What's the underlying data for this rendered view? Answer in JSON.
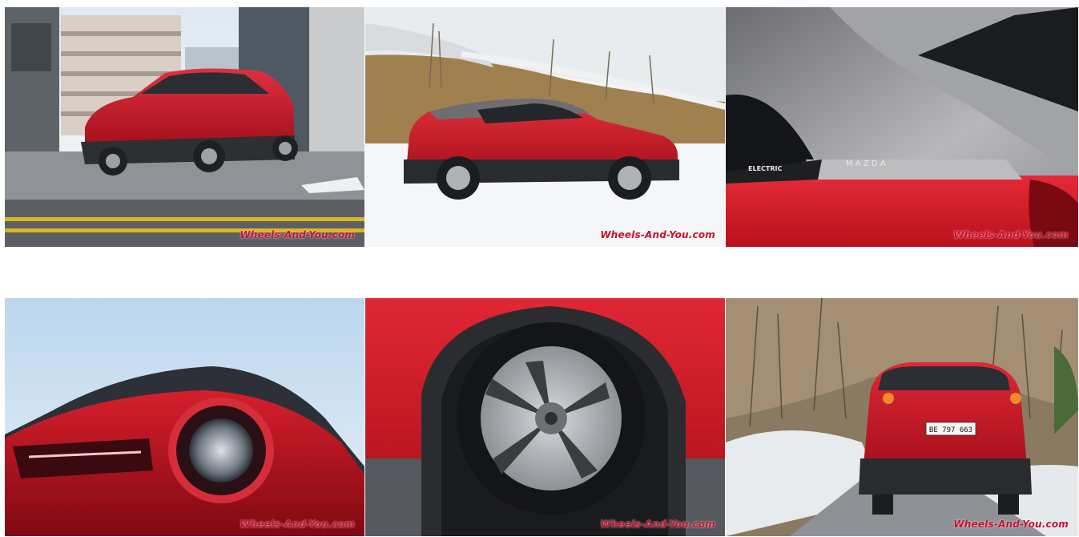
{
  "gallery": {
    "watermark": "Wheels-And-You.com",
    "photos": [
      {
        "subject": "red-suv-front-three-quarter"
      },
      {
        "subject": "red-suv-side-snow"
      },
      {
        "subject": "c-pillar-badge",
        "badge_text": "ELECTRIC",
        "brand_text": "M A Z D A"
      },
      {
        "subject": "tail-light-closeup"
      },
      {
        "subject": "alloy-wheel-closeup"
      },
      {
        "subject": "rear-view-snowy-road",
        "plate_text": "BE 797 663"
      }
    ]
  },
  "colors": {
    "body_red": "#c8141f",
    "watermark_red": "#c8102e",
    "roof_grey": "#6e6e72",
    "snow": "#f2f4f6"
  }
}
